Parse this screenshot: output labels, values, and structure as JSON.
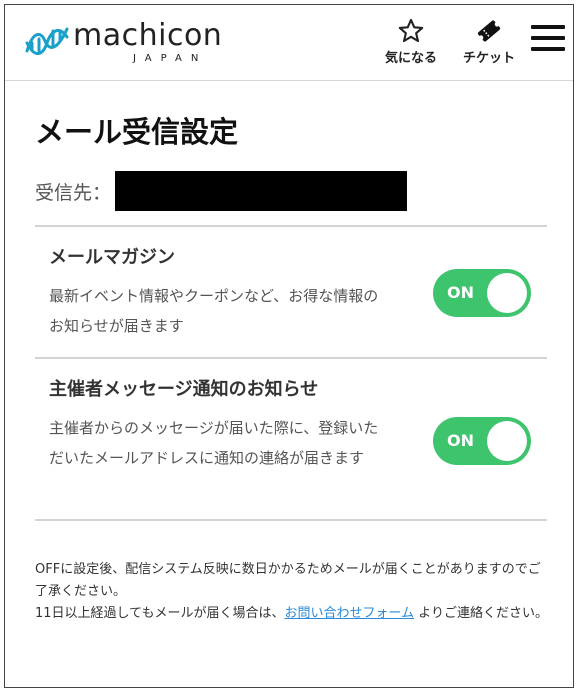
{
  "header": {
    "logo": {
      "word": "machicon",
      "sub": "JAPAN"
    },
    "favorites_label": "気になる",
    "tickets_label": "チケット",
    "menu_icon": "hamburger-menu-icon"
  },
  "page": {
    "title": "メール受信設定",
    "recipient_label": "受信先：",
    "recipient_value": ""
  },
  "settings": [
    {
      "title": "メールマガジン",
      "description": "最新イベント情報やクーポンなど、お得な情報のお知らせが届きます",
      "toggle_label": "ON",
      "enabled": true
    },
    {
      "title": "主催者メッセージ通知のお知らせ",
      "description": "主催者からのメッセージが届いた際に、登録いただいたメールアドレスに通知の連絡が届きます",
      "toggle_label": "ON",
      "enabled": true
    }
  ],
  "notes": {
    "line1": "OFFに設定後、配信システム反映に数日かかるためメールが届くことがありますのでご了承ください。",
    "line2_before": "11日以上経過してもメールが届く場合は、",
    "line2_link": "お問い合わせフォーム",
    "line2_after": " よりご連絡ください。"
  },
  "colors": {
    "toggle_on": "#3ec46d",
    "logo_accent": "#1aa0c9",
    "link": "#2b8ad9"
  }
}
